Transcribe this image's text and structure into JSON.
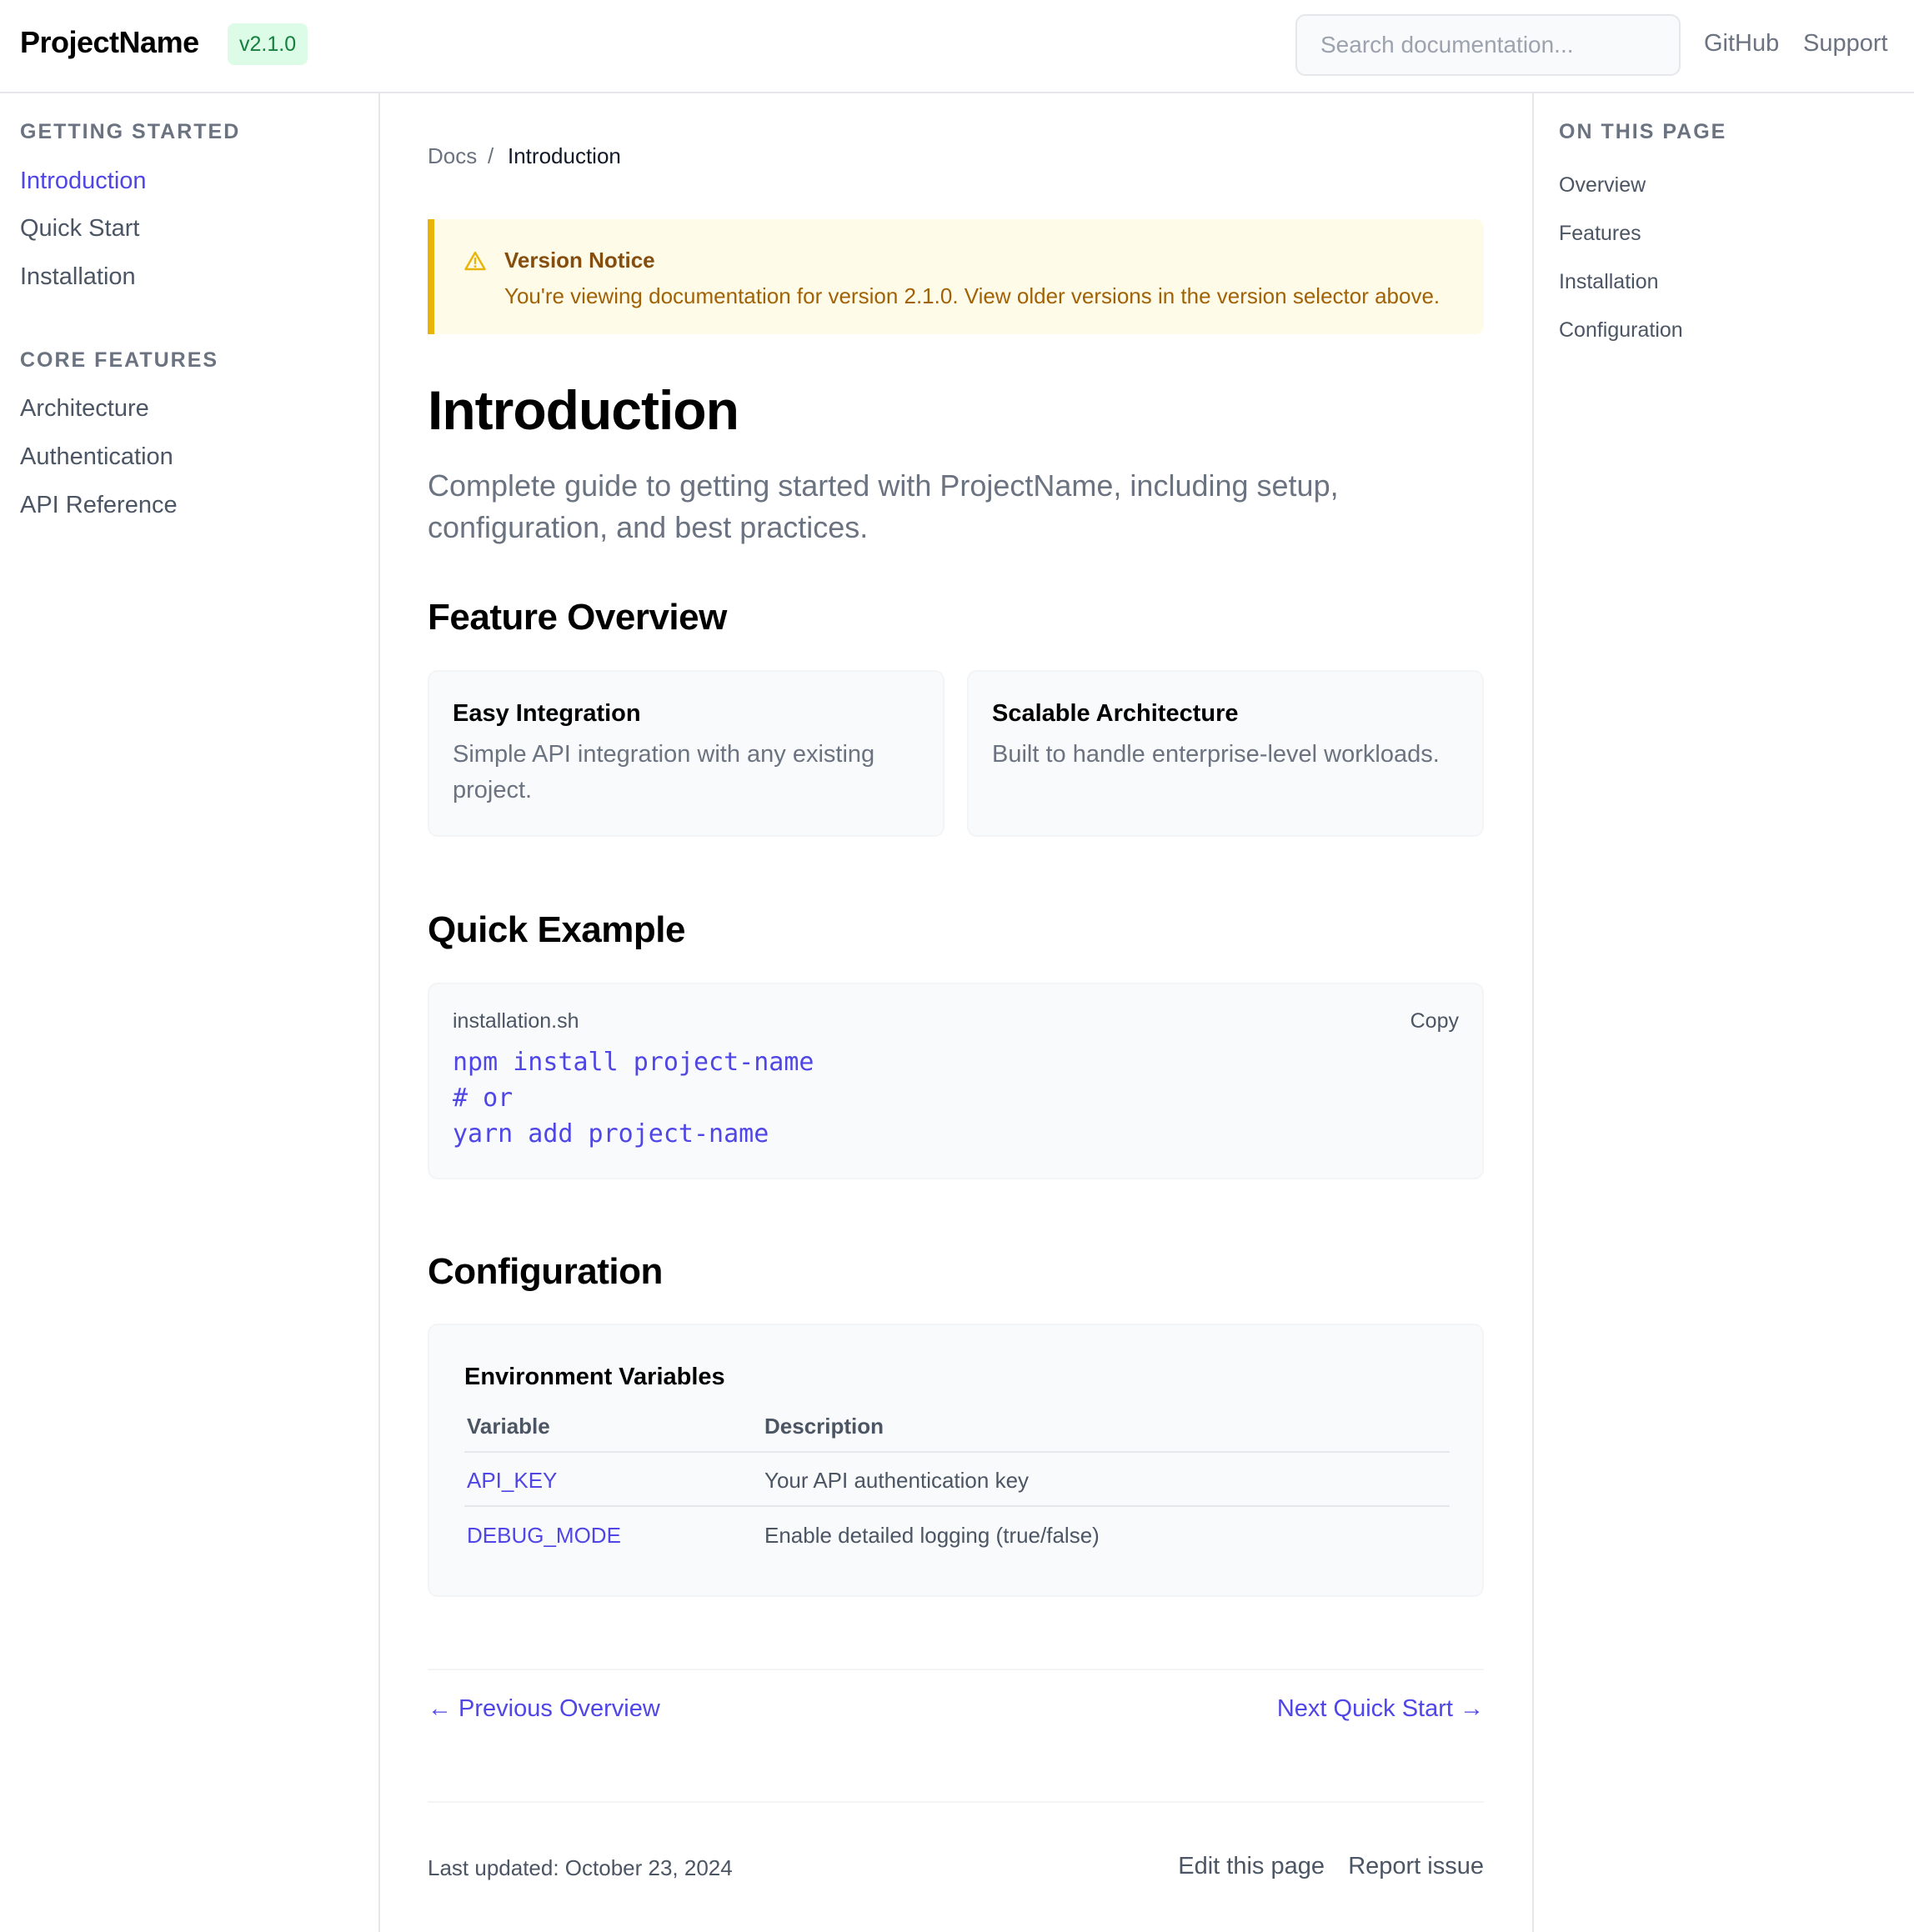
{
  "header": {
    "brand": "ProjectName",
    "version": "v2.1.0",
    "search_placeholder": "Search documentation...",
    "links": [
      "GitHub",
      "Support"
    ]
  },
  "sidebar": {
    "sections": [
      {
        "heading": "GETTING STARTED",
        "items": [
          "Introduction",
          "Quick Start",
          "Installation"
        ]
      },
      {
        "heading": "CORE FEATURES",
        "items": [
          "Architecture",
          "Authentication",
          "API Reference"
        ]
      }
    ],
    "active_item": "Introduction"
  },
  "breadcrumb": {
    "root": "Docs",
    "separator": "/",
    "current": "Introduction"
  },
  "notice": {
    "title": "Version Notice",
    "text": "You're viewing documentation for version 2.1.0. View older versions in the version selector above."
  },
  "page": {
    "title": "Introduction",
    "lead": "Complete guide to getting started with ProjectName, including setup, configuration, and best practices."
  },
  "features": {
    "heading": "Feature Overview",
    "cards": [
      {
        "title": "Easy Integration",
        "desc": "Simple API integration with any existing project."
      },
      {
        "title": "Scalable Architecture",
        "desc": "Built to handle enterprise-level workloads."
      }
    ]
  },
  "example": {
    "heading": "Quick Example",
    "filename": "installation.sh",
    "copy_label": "Copy",
    "lines": [
      "npm install project-name",
      "# or",
      "yarn add project-name"
    ]
  },
  "configuration": {
    "heading": "Configuration",
    "table_title": "Environment Variables",
    "columns": [
      "Variable",
      "Description"
    ],
    "rows": [
      {
        "variable": "API_KEY",
        "description": "Your API authentication key"
      },
      {
        "variable": "DEBUG_MODE",
        "description": "Enable detailed logging (true/false)"
      }
    ]
  },
  "pager": {
    "prev": "← Previous Overview",
    "next": "Next Quick Start →"
  },
  "footer": {
    "last_updated": "Last updated: October 23, 2024",
    "edit_label": "Edit this page",
    "report_label": "Report issue"
  },
  "toc": {
    "heading": "ON THIS PAGE",
    "items": [
      "Overview",
      "Features",
      "Installation",
      "Configuration"
    ]
  },
  "colors": {
    "accent": "#4f46e5",
    "notice_border": "#eab308",
    "badge_bg": "#dcfce7"
  }
}
